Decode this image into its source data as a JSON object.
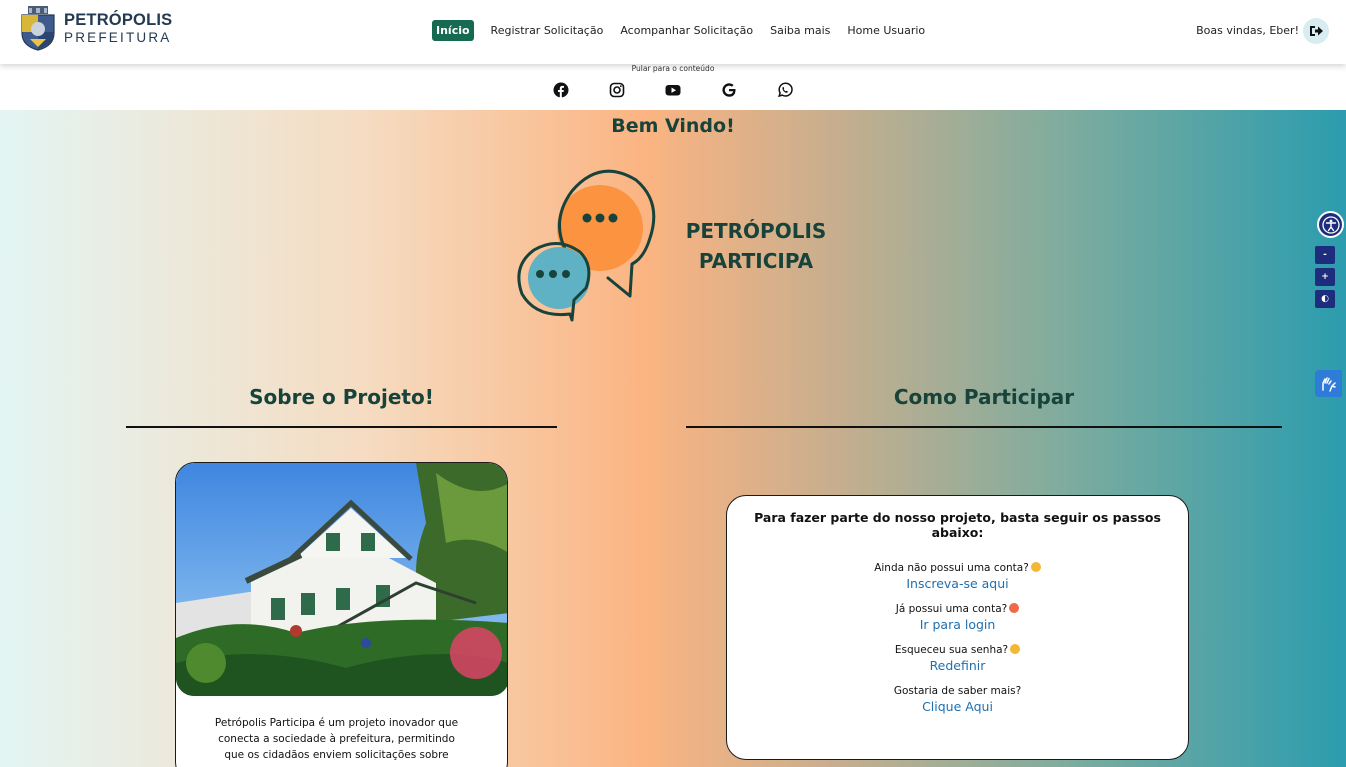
{
  "header": {
    "logo_line1": "PETRÓPOLIS",
    "logo_line2": "PREFEITURA",
    "nav": [
      "Início",
      "Registrar Solicitação",
      "Acompanhar Solicitação",
      "Saiba mais",
      "Home Usuario"
    ],
    "welcome": "Boas vindas, Eber!"
  },
  "skip_link": "Pular para o conteúdo",
  "social_icons": [
    "facebook-icon",
    "instagram-icon",
    "youtube-icon",
    "google-icon",
    "whatsapp-icon"
  ],
  "hero": {
    "welcome_title": "Bem Vindo!",
    "brand_line1": "PETRÓPOLIS",
    "brand_line2": "PARTICIPA"
  },
  "about": {
    "title": "Sobre o Projeto!",
    "text": "Petrópolis Participa é um projeto inovador que conecta a sociedade à prefeitura, permitindo que os cidadãos enviem solicitações sobre"
  },
  "participate": {
    "title": "Como Participar",
    "intro": "Para fazer parte do nosso projeto, basta seguir os passos abaixo:",
    "steps": [
      {
        "question": "Ainda não possui uma conta?",
        "link": "Inscreva-se aqui"
      },
      {
        "question": "Já possui uma conta?",
        "link": "Ir para login"
      },
      {
        "question": "Esqueceu sua senha?",
        "link": "Redefinir"
      },
      {
        "question": "Gostaria de saber mais?",
        "link": "Clique Aqui"
      }
    ]
  },
  "accessibility": {
    "decrease": "-",
    "increase": "+",
    "contrast": "◐"
  },
  "colors": {
    "brand_green": "#166a51",
    "heading": "#17433b",
    "link": "#1f6fb0",
    "bubble_orange": "#fb9341",
    "bubble_teal": "#5fb2c4"
  }
}
